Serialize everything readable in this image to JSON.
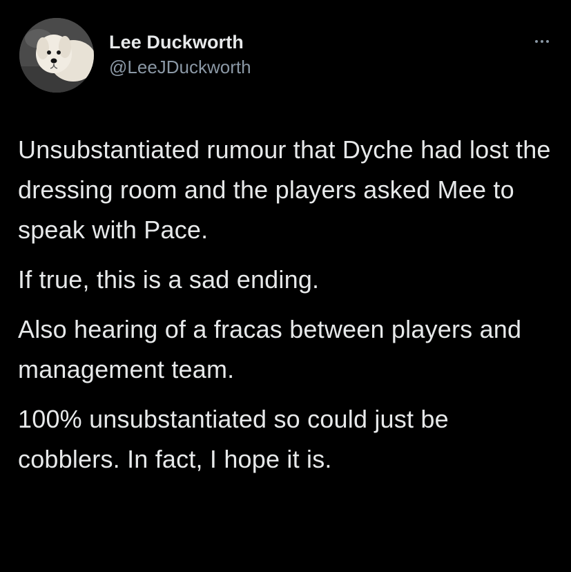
{
  "author": {
    "display_name": "Lee Duckworth",
    "handle": "@LeeJDuckworth",
    "avatar_icon": "dog-avatar"
  },
  "more_icon": "more-options-icon",
  "colors": {
    "background": "#000000",
    "text_primary": "#e7e9ea",
    "text_secondary": "#8b98a5"
  },
  "tweet": {
    "paragraphs": [
      "Unsubstantiated rumour that Dyche had lost the dressing room and the players asked Mee to speak with Pace.",
      "If true, this is a sad ending.",
      "Also hearing of a fracas between players and management team.",
      "100% unsubstantiated so could just be cobblers. In fact, I hope it is."
    ]
  }
}
